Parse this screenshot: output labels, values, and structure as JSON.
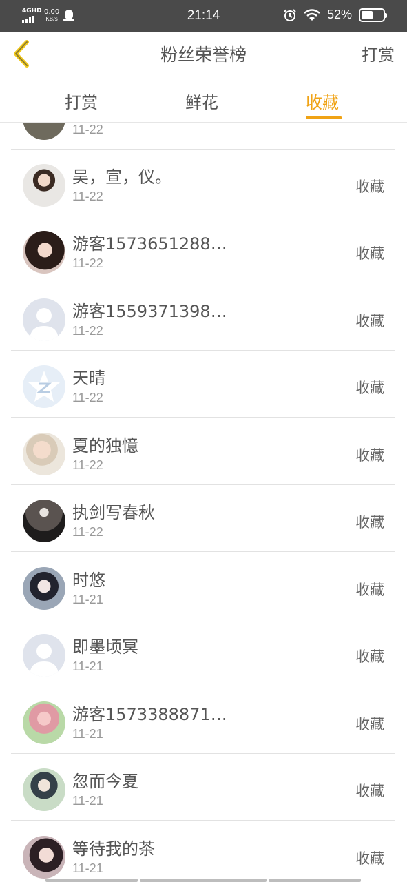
{
  "status_bar": {
    "network": "4GHD",
    "speed_value": "0.00",
    "speed_unit": "KB/s",
    "time": "21:14",
    "battery_percent": "52%",
    "battery_level": 0.52
  },
  "nav": {
    "title": "粉丝荣誉榜",
    "action_label": "打赏"
  },
  "tabs": [
    {
      "label": "打赏",
      "active": false
    },
    {
      "label": "鲜花",
      "active": false
    },
    {
      "label": "收藏",
      "active": true
    }
  ],
  "accent_color": "#f0a315",
  "list": [
    {
      "name": "",
      "date": "11-22",
      "action": ""
    },
    {
      "name": "吴，宣，仪。",
      "date": "11-22",
      "action": "收藏"
    },
    {
      "name": "游客1573651288…",
      "date": "11-22",
      "action": "收藏"
    },
    {
      "name": "游客1559371398…",
      "date": "11-22",
      "action": "收藏"
    },
    {
      "name": "天晴",
      "date": "11-22",
      "action": "收藏"
    },
    {
      "name": "夏的独憶",
      "date": "11-22",
      "action": "收藏"
    },
    {
      "name": "执剑写春秋",
      "date": "11-22",
      "action": "收藏"
    },
    {
      "name": "时悠",
      "date": "11-21",
      "action": "收藏"
    },
    {
      "name": "即墨顷冥",
      "date": "11-21",
      "action": "收藏"
    },
    {
      "name": "游客1573388871…",
      "date": "11-21",
      "action": "收藏"
    },
    {
      "name": "忽而今夏",
      "date": "11-21",
      "action": "收藏"
    },
    {
      "name": "等待我的茶",
      "date": "11-21",
      "action": "收藏"
    }
  ]
}
